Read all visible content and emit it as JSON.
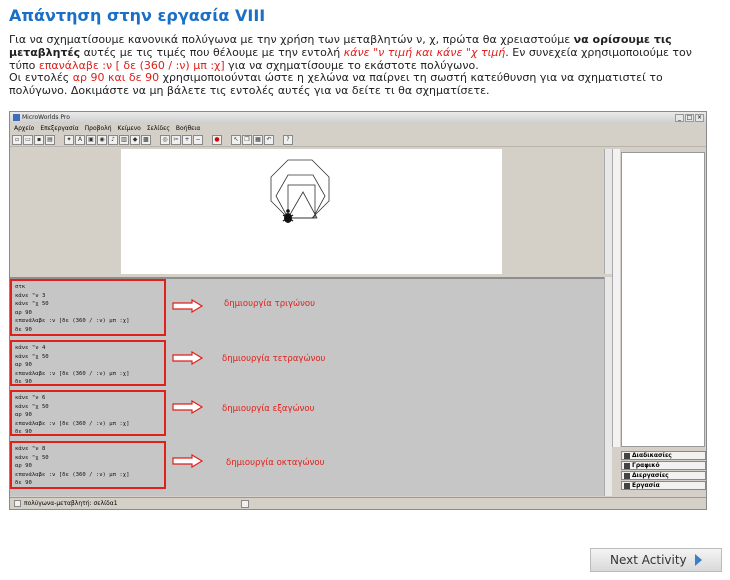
{
  "page": {
    "title": "Απάντηση στην εργασία VIII",
    "desc_p1": "Για να σχηματίσουμε κανονικά πολύγωνα με την χρήση των μεταβλητών ν, χ, πρώτα θα χρειαστούμε ",
    "desc_b1": "να ορίσουμε τις μεταβλητές",
    "desc_p2": " αυτές με τις τιμές που θέλουμε με την εντολή ",
    "desc_r1": "κάνε \"ν τιμή και κάνε \"χ τιμή",
    "desc_p3": ". Εν συνεχεία χρησιμοποιούμε τον τύπο ",
    "desc_r2": "επανάλαβε :ν [ δε (360 / :ν) μπ :χ]",
    "desc_p4": " για να σχηματίσουμε το εκάστοτε πολύγωνο.",
    "desc_p5": "Οι εντολές ",
    "desc_r3": "αρ 90 και δε 90",
    "desc_p6": " χρησιμοποιούνται ώστε η χελώνα να παίρνει τη σωστή κατεύθυνση για να σχηματιστεί το πολύγωνο. Δοκιμάστε να μη βάλετε τις εντολές αυτές για να δείτε τι θα σχηματίσετε."
  },
  "app": {
    "title": "MicroWorlds Pro",
    "menu": [
      "Αρχείο",
      "Επεξεργασία",
      "Προβολή",
      "Κείμενο",
      "Σελίδες",
      "Βοήθεια"
    ],
    "window_buttons": [
      "_",
      "□",
      "×"
    ],
    "tabs": [
      "Διαδικασίες",
      "Γραφικό",
      "Διεργασίες",
      "Εργασία"
    ],
    "status": "πολύγωνα-μεταβλητή: σελίδα1"
  },
  "blocks": [
    {
      "lines": [
        "στκ",
        "κάνε \"ν 3",
        "κάνε \"χ 50",
        "αρ 90",
        "επανάλαβε :ν [δε (360 / :ν) μπ :χ]",
        "δε 90"
      ],
      "label": "δημιουργία τριγώνου"
    },
    {
      "lines": [
        "κάνε \"ν 4",
        "κάνε \"χ 50",
        "αρ 90",
        "επανάλαβε :ν [δε (360 / :ν) μπ :χ]",
        "δε 90"
      ],
      "label": "δημιουργία τετραγώνου"
    },
    {
      "lines": [
        "κάνε \"ν 6",
        "κάνε \"χ 50",
        "αρ 90",
        "επανάλαβε :ν [δε (360 / :ν) μπ :χ]",
        "δε 90"
      ],
      "label": "δημιουργία εξαγώνου"
    },
    {
      "lines": [
        "κάνε \"ν 8",
        "κάνε \"χ 50",
        "αρ 90",
        "επανάλαβε :ν [δε (360 / :ν) μπ :χ]",
        "δε 90"
      ],
      "label": "δημιουργία οκταγώνου"
    }
  ],
  "next_label": "Next Activity",
  "colors": {
    "title": "#1a6fc7",
    "highlight": "#e0201a"
  }
}
